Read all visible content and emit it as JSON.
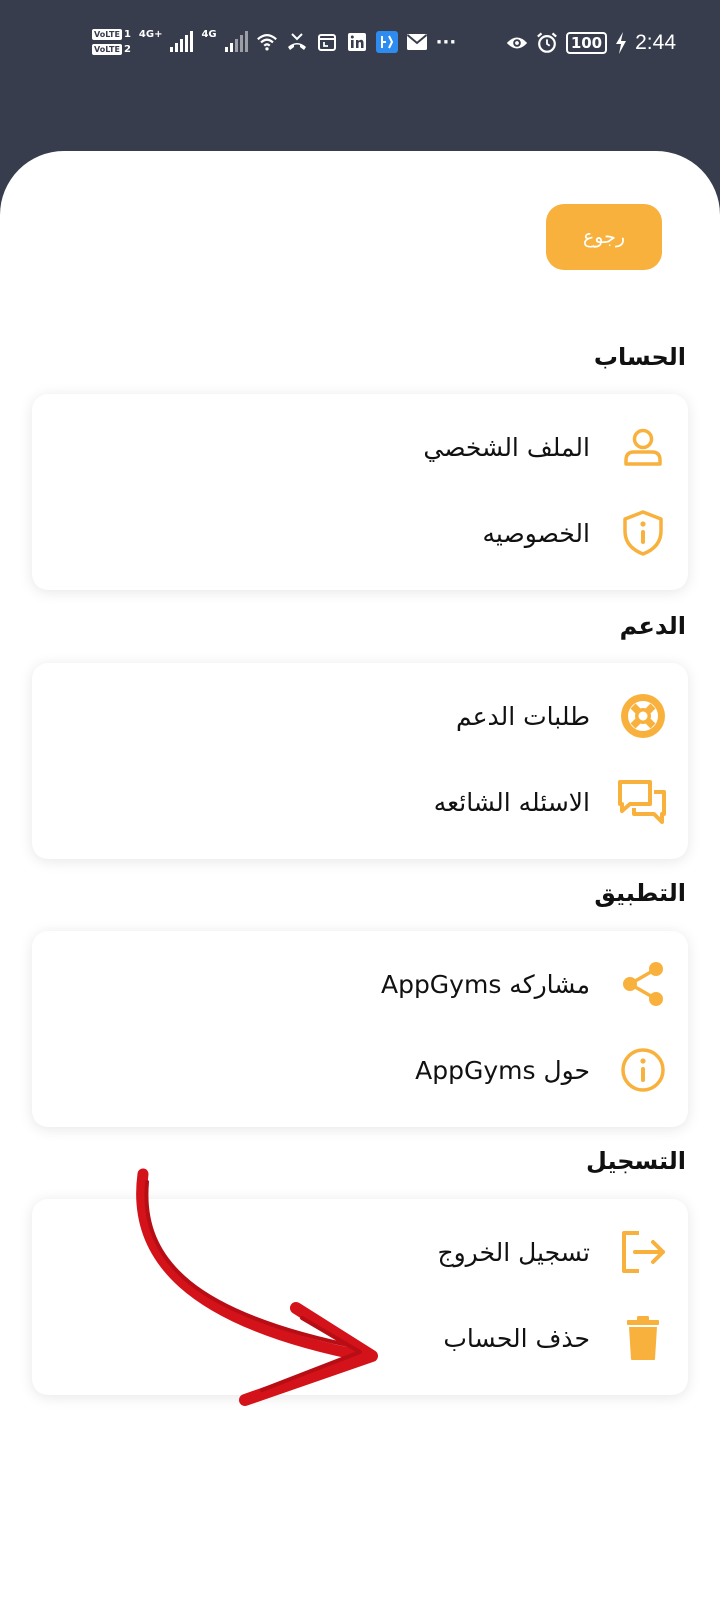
{
  "status_bar": {
    "volte1": "VoLTE",
    "volte1_slot": "1",
    "volte2": "VoLTE",
    "volte2_slot": "2",
    "net1": "4G+",
    "net2": "4G",
    "more": "···",
    "battery": "100",
    "time": "2:44"
  },
  "header": {
    "back_label": "رجوع"
  },
  "colors": {
    "accent": "#f9b13d",
    "status_bg": "#383d4d",
    "arrow": "#d4121a"
  },
  "sections": [
    {
      "title": "الحساب",
      "items": [
        {
          "label": "الملف الشخصي",
          "icon": "user-icon"
        },
        {
          "label": "الخصوصيه",
          "icon": "shield-info-icon"
        }
      ]
    },
    {
      "title": "الدعم",
      "items": [
        {
          "label": "طلبات الدعم",
          "icon": "lifebuoy-icon"
        },
        {
          "label": "الاسئله الشائعه",
          "icon": "chat-bubbles-icon"
        }
      ]
    },
    {
      "title": "التطبيق",
      "items": [
        {
          "label": "مشاركه AppGyms",
          "icon": "share-icon"
        },
        {
          "label": "حول AppGyms",
          "icon": "info-icon"
        }
      ]
    },
    {
      "title": "التسجيل",
      "items": [
        {
          "label": "تسجيل الخروج",
          "icon": "logout-icon"
        },
        {
          "label": "حذف الحساب",
          "icon": "trash-icon"
        }
      ]
    }
  ]
}
